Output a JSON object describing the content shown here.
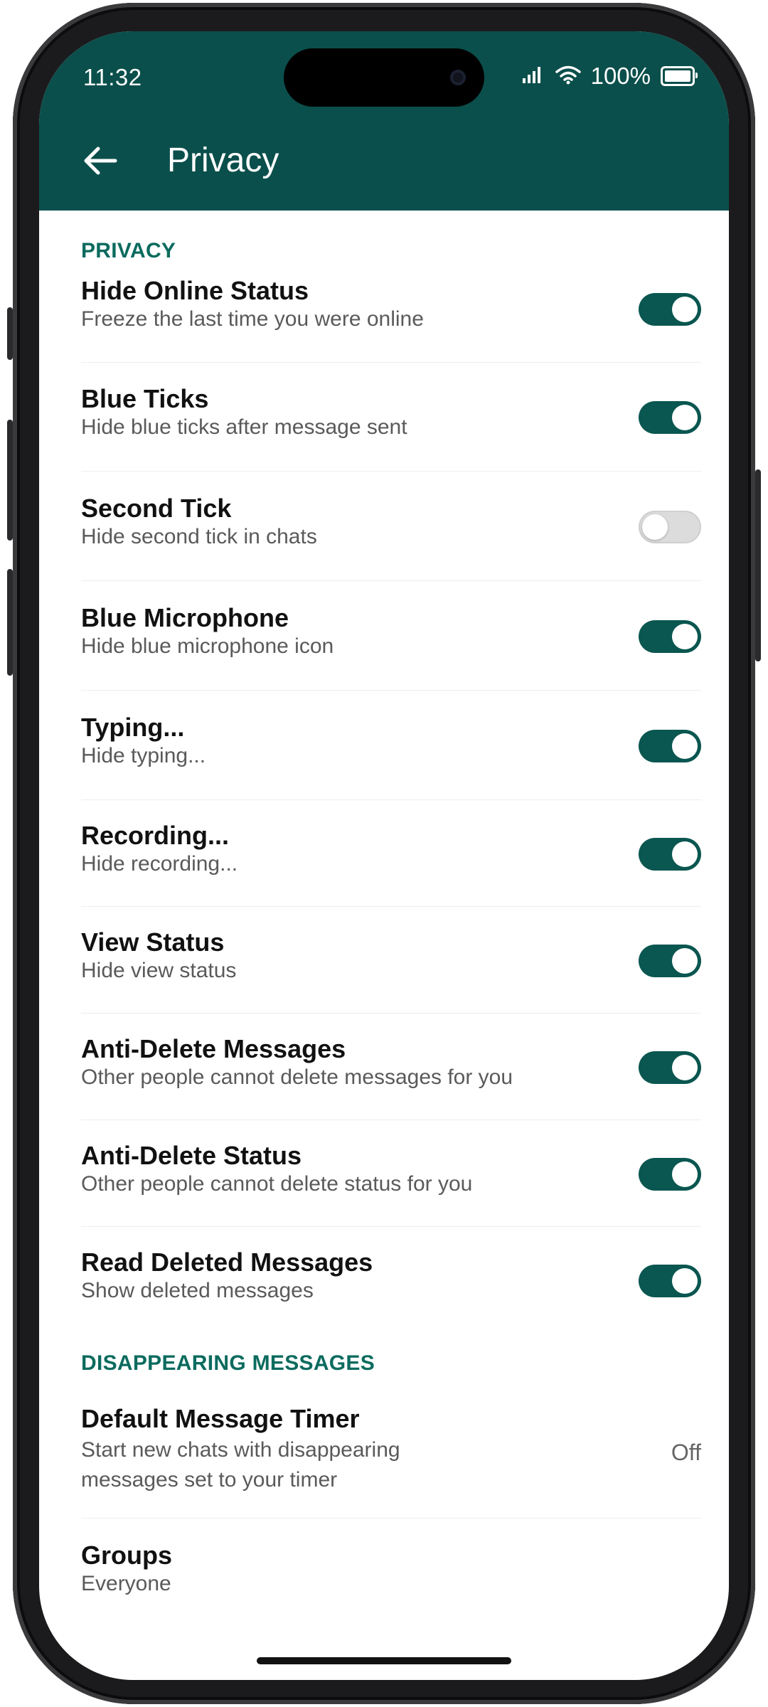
{
  "status_bar": {
    "time": "11:32",
    "battery": "100%",
    "signal_icon": "cellular-signal-icon",
    "wifi_icon": "wifi-icon",
    "battery_icon": "battery-icon"
  },
  "app_bar": {
    "title": "Privacy",
    "back_icon": "arrow-left-icon",
    "color": "#0a4f4b"
  },
  "accent_color": "#0b6b5e",
  "sections": [
    {
      "header": "PRIVACY",
      "items": [
        {
          "title": "Hide Online Status",
          "subtitle": "Freeze the last time you were online",
          "toggle": true
        },
        {
          "title": "Blue Ticks",
          "subtitle": "Hide blue ticks after message sent",
          "toggle": true
        },
        {
          "title": "Second Tick",
          "subtitle": "Hide second tick in chats",
          "toggle": false
        },
        {
          "title": "Blue Microphone",
          "subtitle": "Hide blue microphone icon",
          "toggle": true
        },
        {
          "title": "Typing...",
          "subtitle": "Hide typing...",
          "toggle": true
        },
        {
          "title": "Recording...",
          "subtitle": "Hide recording...",
          "toggle": true
        },
        {
          "title": "View Status",
          "subtitle": "Hide view status",
          "toggle": true
        },
        {
          "title": "Anti-Delete Messages",
          "subtitle": "Other people cannot delete messages for you",
          "toggle": true
        },
        {
          "title": "Anti-Delete Status",
          "subtitle": "Other people cannot delete status for you",
          "toggle": true
        },
        {
          "title": "Read Deleted Messages",
          "subtitle": "Show deleted messages",
          "toggle": true
        }
      ]
    },
    {
      "header": "DISAPPEARING MESSAGES",
      "items": [
        {
          "title": "Default Message Timer",
          "subtitle_lines": [
            "Start new chats with disappearing",
            "messages set to your timer"
          ],
          "value": "Off"
        },
        {
          "title": "Groups",
          "subtitle": "Everyone"
        }
      ]
    }
  ]
}
